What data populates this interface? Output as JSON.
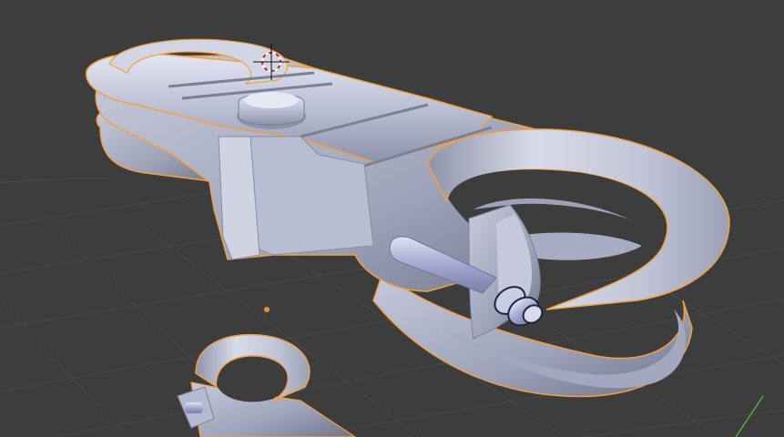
{
  "viewport": {
    "background": "#3d3d3d",
    "grid_color": "#4a4a4a",
    "selection_outline_color": "#f0a040",
    "mesh_color": "#b8bdd6",
    "object_origin_color": "#e8903a",
    "cursor_color_red": "#d0202c",
    "x_axis_color": "#59a839"
  }
}
